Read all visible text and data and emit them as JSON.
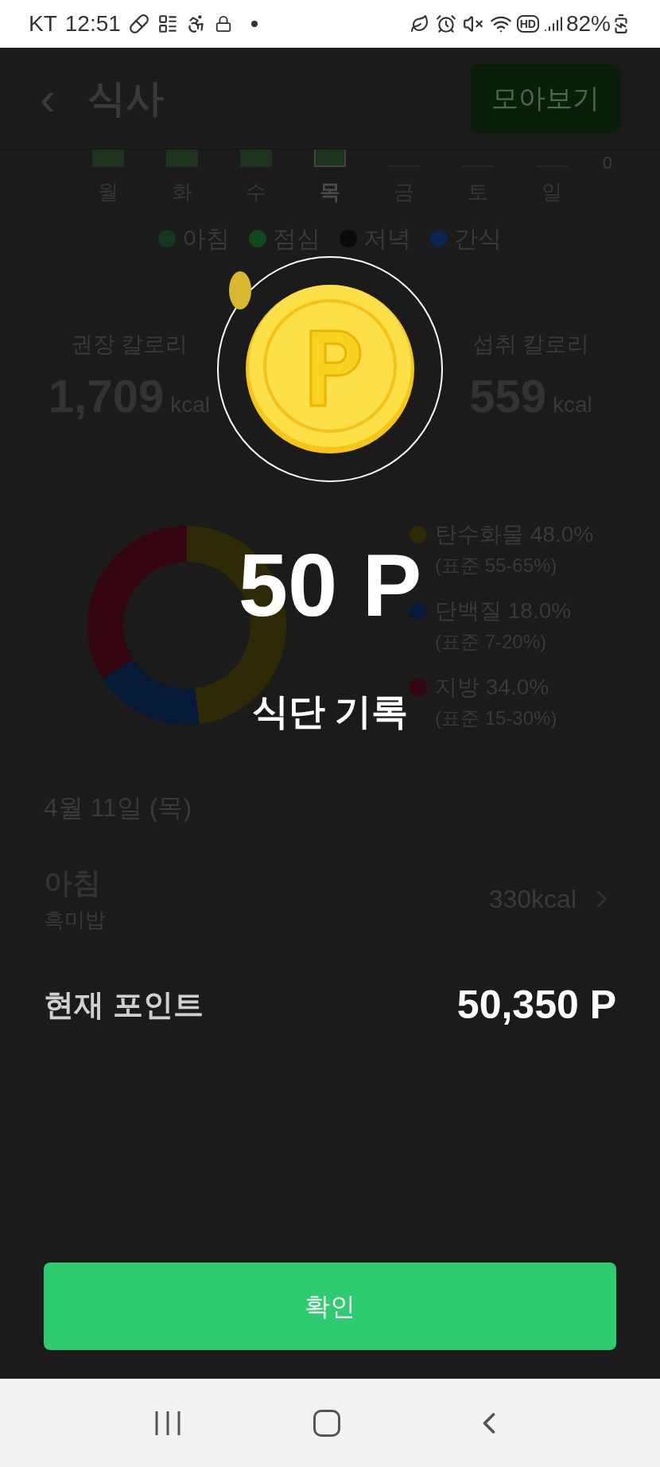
{
  "status_bar": {
    "carrier": "KT",
    "time": "12:51",
    "hd_badge": "HD",
    "battery": "82%"
  },
  "header": {
    "back": "‹",
    "title": "식사",
    "button": "모아보기"
  },
  "week": {
    "axis_label": "0",
    "days": [
      {
        "label": "월",
        "selected": false,
        "has_record": true
      },
      {
        "label": "화",
        "selected": false,
        "has_record": true
      },
      {
        "label": "수",
        "selected": false,
        "has_record": true
      },
      {
        "label": "목",
        "selected": true,
        "has_record": true
      },
      {
        "label": "금",
        "selected": false,
        "has_record": false
      },
      {
        "label": "토",
        "selected": false,
        "has_record": false
      },
      {
        "label": "일",
        "selected": false,
        "has_record": false
      }
    ]
  },
  "meal_legend": [
    {
      "label": "아침",
      "color": "#16381f"
    },
    {
      "label": "점심",
      "color": "#124a1e"
    },
    {
      "label": "저녁",
      "color": "#0a0a0a"
    },
    {
      "label": "간식",
      "color": "#0a2550"
    }
  ],
  "calories": [
    {
      "label": "권장 칼로리",
      "value": "1,709",
      "unit": "kcal"
    },
    {
      "label": "섭취 칼로리",
      "value": "559",
      "unit": "kcal"
    }
  ],
  "nutrients": {
    "chart_data": {
      "type": "donut",
      "values": [
        48.0,
        18.0,
        34.0
      ]
    },
    "legend": [
      {
        "label": "탄수화물 48.0%",
        "standard": "(표준 55-65%)",
        "color": "#2e2a06"
      },
      {
        "label": "단백질 18.0%",
        "standard": "(표준 7-20%)",
        "color": "#051a36"
      },
      {
        "label": "지방 34.0%",
        "standard": "(표준 15-30%)",
        "color": "#35060f"
      }
    ]
  },
  "date": "4월 11일 (목)",
  "meals": [
    {
      "name": "아침",
      "menu": "흑미밥",
      "kcal": "330kcal"
    }
  ],
  "reward": {
    "points": "50 P",
    "reason": "식단 기록"
  },
  "current_points": {
    "label": "현재 포인트",
    "value": "50,350 P"
  },
  "confirm_button": "확인"
}
